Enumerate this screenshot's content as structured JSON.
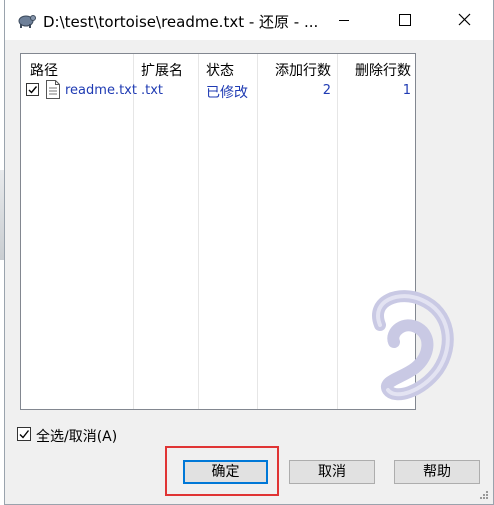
{
  "window": {
    "title": "D:\\test\\tortoise\\readme.txt - 还原 - ...",
    "app_icon": "tortoise-icon",
    "controls": {
      "minimize": "minimize-icon",
      "maximize": "maximize-icon",
      "close": "close-icon"
    }
  },
  "list": {
    "columns": [
      "路径",
      "扩展名",
      "状态",
      "添加行数",
      "删除行数"
    ],
    "rows": [
      {
        "checked": true,
        "path": "readme.txt",
        "extension": ".txt",
        "status": "已修改",
        "added": "2",
        "deleted": "1"
      }
    ],
    "link_color": "#1f3bb3"
  },
  "select_all": {
    "label": "全选/取消(A)",
    "checked": true
  },
  "buttons": {
    "ok": "确定",
    "cancel": "取消",
    "help": "帮助"
  },
  "colors": {
    "accent": "#0078d7",
    "highlight": "#e03434"
  }
}
